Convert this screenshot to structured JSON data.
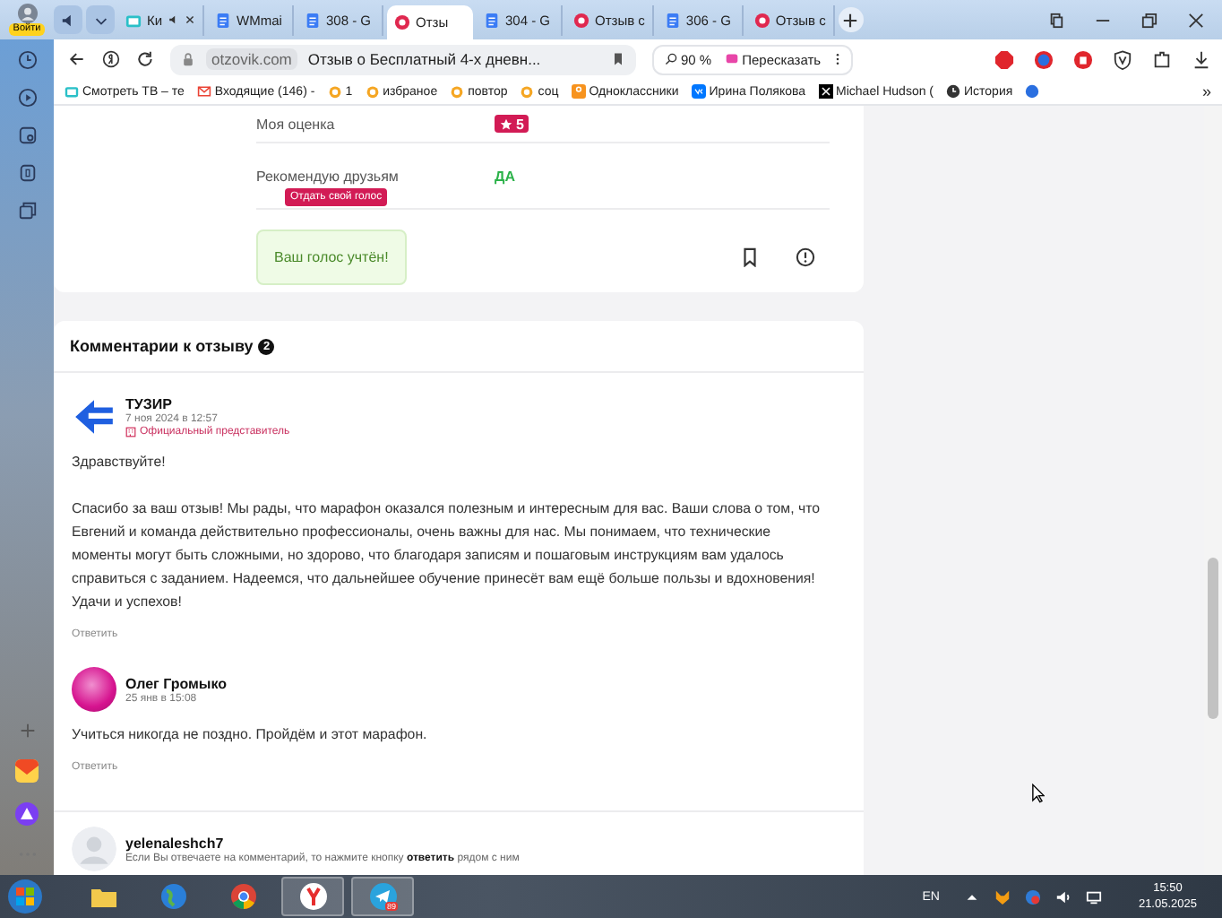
{
  "profile": {
    "label": "Войти"
  },
  "tabs": [
    {
      "label": "Ки",
      "kind": "tv",
      "sound": true,
      "selected": false
    },
    {
      "label": "WMmai",
      "kind": "doc",
      "sound": false,
      "selected": false
    },
    {
      "label": "308 - G",
      "kind": "doc",
      "sound": false,
      "selected": false
    },
    {
      "label": "Отзы",
      "kind": "otz",
      "sound": false,
      "selected": true
    },
    {
      "label": "304 - G",
      "kind": "doc",
      "sound": false,
      "selected": false
    },
    {
      "label": "Отзыв с",
      "kind": "otz",
      "sound": false,
      "selected": false
    },
    {
      "label": "306 - G",
      "kind": "doc",
      "sound": false,
      "selected": false
    },
    {
      "label": "Отзыв с",
      "kind": "otz",
      "sound": false,
      "selected": false
    }
  ],
  "address_bar": {
    "domain": "otzovik.com",
    "title": "Отзыв о Бесплатный 4-х дневн...",
    "zoom": "90 %",
    "summarize": "Пересказать"
  },
  "bookmarks": [
    {
      "label": "Смотреть ТВ – те",
      "kind": "tv"
    },
    {
      "label": "Входящие (146) -",
      "kind": "mail"
    },
    {
      "label": "1",
      "kind": "folder"
    },
    {
      "label": "избраное",
      "kind": "folder"
    },
    {
      "label": "повтор",
      "kind": "folder"
    },
    {
      "label": "соц",
      "kind": "folder"
    },
    {
      "label": "Одноклассники",
      "kind": "ok"
    },
    {
      "label": "Ирина Полякова",
      "kind": "vk"
    },
    {
      "label": "Michael Hudson (",
      "kind": "x"
    },
    {
      "label": "История",
      "kind": "clock"
    }
  ],
  "bookmarks_more": "»",
  "review": {
    "rating_label": "Моя оценка",
    "rating": "5",
    "recommend_label": "Рекомендую друзьям",
    "recommend_value": "ДА",
    "tooltip": "Отдать свой голос",
    "vote_message": "Ваш голос учтён!"
  },
  "comments": {
    "title": "Комментарии к отзыву",
    "count": "2",
    "items": [
      {
        "author": "ТУЗИР",
        "kind": "logo",
        "date": "7 ноя 2024 в 12:57",
        "badge": "Официальный представитель",
        "paragraphs": [
          "Здравствуйте!",
          "Спасибо за ваш отзыв! Мы рады, что марафон оказался полезным и интересным для вас. Ваши слова о том, что Евгений и команда действительно профессионалы, очень важны для нас. Мы понимаем, что технические моменты могут быть сложными, но здорово, что благодаря записям и пошаговым инструкциям вам удалось справиться с заданием. Надеемся, что дальнейшее обучение принесёт вам ещё больше пользы и вдохновения! Удачи и успехов!"
        ],
        "reply": "Ответить"
      },
      {
        "author": "Олег Громыко",
        "kind": "photo",
        "date": "25 янв в 15:08",
        "paragraphs": [
          "Учиться никогда не поздно. Пройдём и этот марафон."
        ],
        "reply": "Ответить"
      }
    ],
    "composer": {
      "user": "yelenaleshch7",
      "hint": "Если Вы отвечаете на комментарий, то нажмите кнопку **ответить** рядом с ним"
    }
  },
  "taskbar": {
    "telegram_badge": "89",
    "language": "EN",
    "time": "15:50",
    "date": "21.05.2025"
  }
}
